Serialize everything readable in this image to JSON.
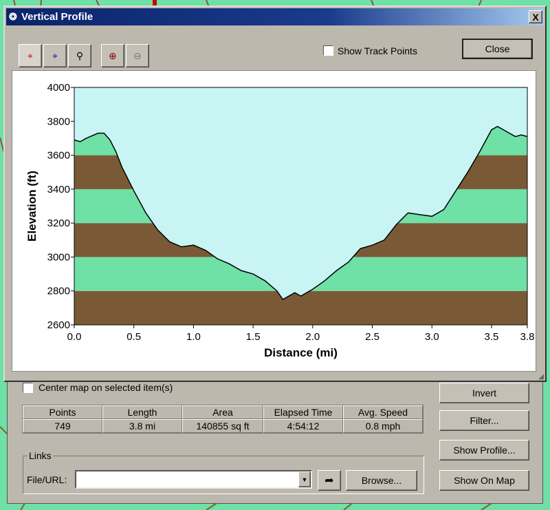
{
  "window": {
    "title": "Vertical Profile",
    "close_x": "X"
  },
  "toolbar": {
    "icons": [
      "select-red-crosshair-icon",
      "select-blue-crosshair-icon",
      "zoom-region-icon",
      "zoom-in-icon",
      "zoom-out-icon"
    ],
    "show_track_points_label": "Show Track Points",
    "show_track_points_checked": false,
    "close_label": "Close"
  },
  "colors": {
    "sky": "#c8f4f4",
    "brown": "#7a5a36",
    "green": "#6fe0a6",
    "line": "#000000"
  },
  "chart_data": {
    "type": "area",
    "xlabel": "Distance   (mi)",
    "ylabel": "Elevation (ft)",
    "xlim": [
      0,
      3.8
    ],
    "ylim": [
      2600,
      4000
    ],
    "xticks": [
      "0.0",
      "0.5",
      "1.0",
      "1.5",
      "2.0",
      "2.5",
      "3.0",
      "3.5",
      "3.8"
    ],
    "yticks": [
      "2600",
      "2800",
      "3000",
      "3200",
      "3400",
      "3600",
      "3800",
      "4000"
    ],
    "bands": [
      {
        "from": 2600,
        "to": 2800,
        "color": "brown"
      },
      {
        "from": 2800,
        "to": 3000,
        "color": "green"
      },
      {
        "from": 3000,
        "to": 3200,
        "color": "brown"
      },
      {
        "from": 3200,
        "to": 3400,
        "color": "green"
      },
      {
        "from": 3400,
        "to": 3600,
        "color": "brown"
      },
      {
        "from": 3600,
        "to": 3800,
        "color": "green"
      },
      {
        "from": 3800,
        "to": 4000,
        "color": "brown"
      }
    ],
    "x": [
      0,
      0.05,
      0.1,
      0.2,
      0.25,
      0.3,
      0.35,
      0.4,
      0.5,
      0.6,
      0.7,
      0.8,
      0.9,
      1.0,
      1.1,
      1.2,
      1.3,
      1.4,
      1.5,
      1.6,
      1.7,
      1.75,
      1.85,
      1.9,
      2.0,
      2.1,
      2.2,
      2.3,
      2.4,
      2.5,
      2.6,
      2.7,
      2.8,
      2.9,
      3.0,
      3.1,
      3.2,
      3.3,
      3.4,
      3.5,
      3.55,
      3.6,
      3.7,
      3.75,
      3.8
    ],
    "y": [
      3690,
      3680,
      3700,
      3730,
      3730,
      3690,
      3620,
      3530,
      3390,
      3260,
      3160,
      3090,
      3060,
      3070,
      3040,
      2990,
      2960,
      2920,
      2900,
      2860,
      2800,
      2750,
      2790,
      2770,
      2810,
      2860,
      2920,
      2970,
      3050,
      3070,
      3100,
      3190,
      3260,
      3250,
      3240,
      3280,
      3390,
      3500,
      3620,
      3750,
      3770,
      3750,
      3710,
      3720,
      3710
    ]
  },
  "lower": {
    "center_map_label": "Center map on selected item(s)",
    "stats_headers": [
      "Points",
      "Length",
      "Area",
      "Elapsed Time",
      "Avg. Speed"
    ],
    "stats_values": [
      "749",
      "3.8 mi",
      "140855 sq ft",
      "4:54:12",
      "0.8 mph"
    ],
    "links_label": "Links",
    "file_url_label": "File/URL:",
    "file_url_value": "",
    "browse_label": "Browse...",
    "buttons": [
      "Invert",
      "Filter...",
      "Show Profile...",
      "Show On Map"
    ]
  }
}
